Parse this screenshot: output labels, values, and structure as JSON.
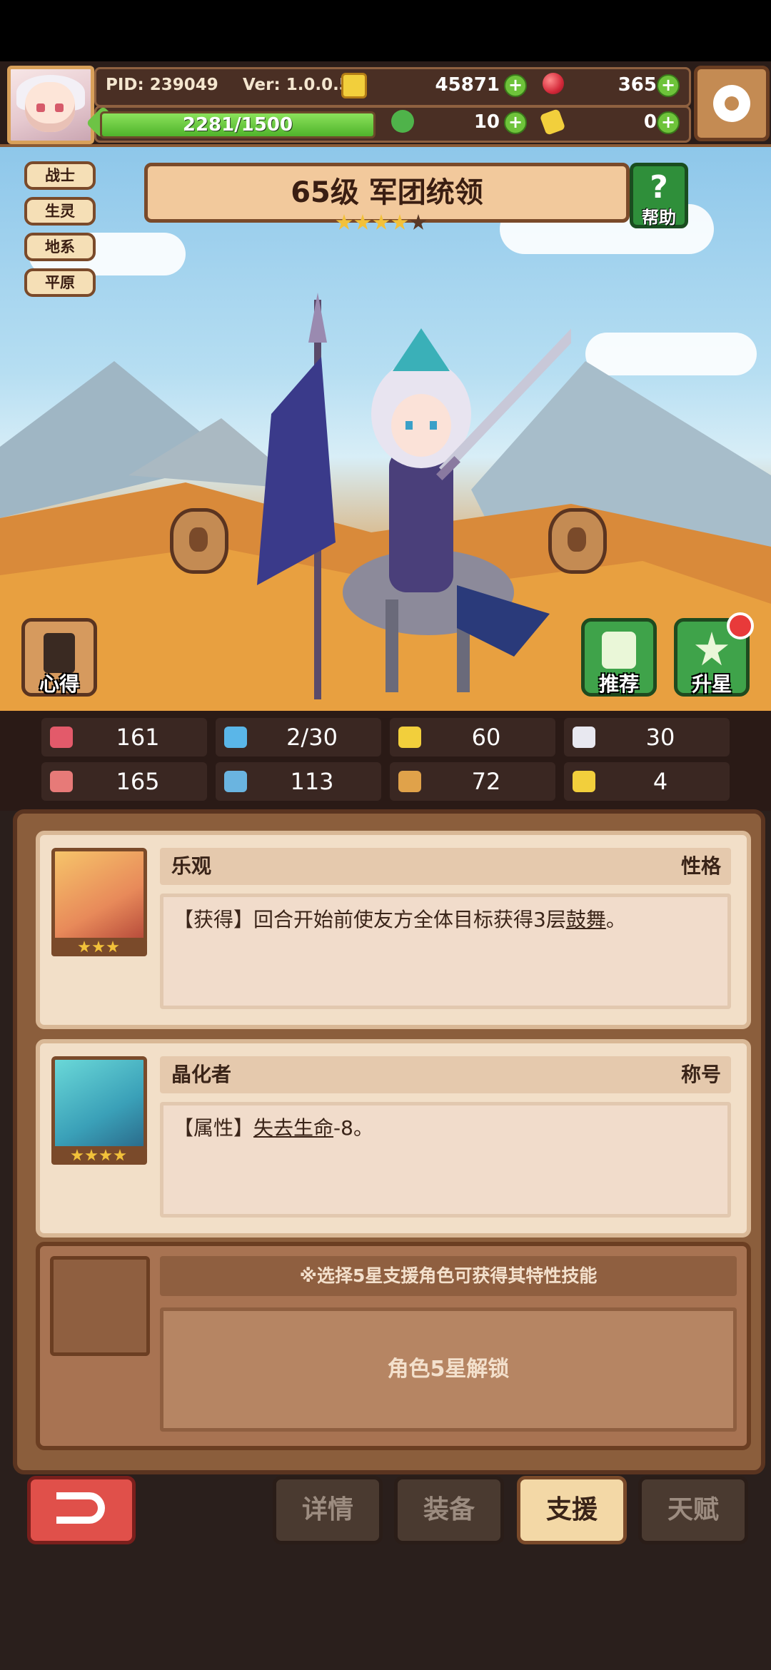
{
  "header": {
    "pid": "PID: 239049",
    "version": "Ver: 1.0.0.5",
    "xp_text": "2281/1500",
    "xp_fraction": 1.0,
    "gold": "45871",
    "ruby": "365",
    "clover": "10",
    "ticket": "0",
    "icons": [
      "coin-icon",
      "ruby-icon",
      "clover-icon",
      "ticket-icon",
      "settings-gear-icon"
    ]
  },
  "hero": {
    "title": "65级 军团统领",
    "stars_filled": 4,
    "stars_total": 5,
    "tags": [
      "战士",
      "生灵",
      "地系",
      "平原"
    ],
    "help_label": "帮助",
    "notes_label": "心得",
    "recommend_label": "推荐",
    "star_up_label": "升星"
  },
  "stats": [
    {
      "icon": "heart-icon",
      "value": "161",
      "color": "#e35a6a"
    },
    {
      "icon": "water-drop-icon",
      "value": "2/30",
      "color": "#5ab6e8"
    },
    {
      "icon": "shield-icon",
      "value": "60",
      "color": "#f2cf3c"
    },
    {
      "icon": "wing-icon",
      "value": "30",
      "color": "#e8e8f0"
    },
    {
      "icon": "fist-icon",
      "value": "165",
      "color": "#e77a78"
    },
    {
      "icon": "book-icon",
      "value": "113",
      "color": "#6ab4e0"
    },
    {
      "icon": "banner-icon",
      "value": "72",
      "color": "#e0a24a"
    },
    {
      "icon": "horseshoe-icon",
      "value": "4",
      "color": "#f2cf3c"
    }
  ],
  "cards": [
    {
      "name": "乐观",
      "type": "性格",
      "desc_prefix": "【获得】回合开始前使友方全体目标获得3层",
      "desc_link": "鼓舞",
      "desc_suffix": "。",
      "stars": 3
    },
    {
      "name": "晶化者",
      "type": "称号",
      "desc_prefix": "【属性】",
      "desc_link": "失去生命",
      "desc_suffix": "-8。",
      "stars": 4
    }
  ],
  "support_slot": {
    "hint": "※选择5星支援角色可获得其特性技能",
    "locked": "角色5星解锁"
  },
  "nav": {
    "tabs": [
      "详情",
      "装备",
      "支援",
      "天赋"
    ],
    "active": "支援"
  }
}
